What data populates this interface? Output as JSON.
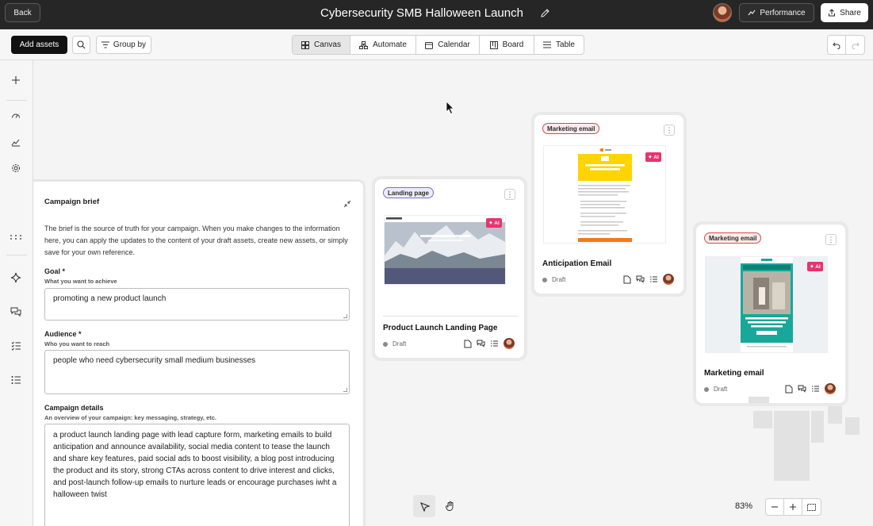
{
  "topbar": {
    "back_label": "Back",
    "title": "Cybersecurity SMB Halloween Launch",
    "performance_label": "Performance",
    "share_label": "Share"
  },
  "toolbar": {
    "add_assets_label": "Add assets",
    "group_by_label": "Group by",
    "views": [
      {
        "label": "Canvas",
        "icon": "canvas-icon",
        "active": true
      },
      {
        "label": "Automate",
        "icon": "automate-icon",
        "active": false
      },
      {
        "label": "Calendar",
        "icon": "calendar-icon",
        "active": false
      },
      {
        "label": "Board",
        "icon": "board-icon",
        "active": false
      },
      {
        "label": "Table",
        "icon": "table-icon",
        "active": false
      }
    ]
  },
  "brief": {
    "title": "Campaign brief",
    "description": "The brief is the source of truth for your campaign. When you make changes to the information here, you can apply the updates to the content of your draft assets, create new assets, or simply save for your own reference.",
    "goal": {
      "label": "Goal *",
      "sublabel": "What you want to achieve",
      "value": "promoting a new product launch"
    },
    "audience": {
      "label": "Audience *",
      "sublabel": "Who you want to reach",
      "value": "people who need cybersecurity small medium businesses"
    },
    "details": {
      "label": "Campaign details",
      "sublabel": "An overview of your campaign: key messaging, strategy, etc.",
      "value": "a product launch landing page with lead capture form, marketing emails to build anticipation and announce availability, social media content to tease the launch and share key features, paid social ads to boost visibility, a blog post introducing the product and its story, strong CTAs across content to drive interest and clicks, and post-launch follow-up emails to nurture leads or encourage purchases iwht a halloween twist"
    }
  },
  "cards": {
    "landing": {
      "tag": "Landing page",
      "name": "Product Launch Landing Page",
      "status": "Draft",
      "ai_label": "✦ AI"
    },
    "anticipation": {
      "tag": "Marketing email",
      "name": "Anticipation Email",
      "status": "Draft",
      "ai_label": "✦ AI"
    },
    "marketing": {
      "tag": "Marketing email",
      "name": "Marketing email",
      "status": "Draft",
      "ai_label": "✦ AI"
    }
  },
  "zoom": {
    "level": "83%"
  },
  "colors": {
    "topbar_bg": "#262626",
    "ai_badge": "#e8336e",
    "email_yellow": "#ffd400",
    "email_teal": "#17a89a",
    "cta_orange": "#f07a1a"
  }
}
